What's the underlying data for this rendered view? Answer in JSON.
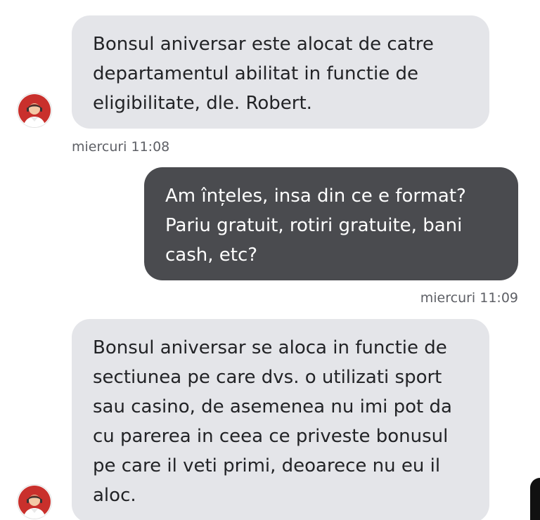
{
  "conversation": {
    "messages": [
      {
        "sender": "agent",
        "text": "Bonsul aniversar este alocat de catre departamentul abilitat in functie de eligibilitate, dle. Robert.",
        "timestamp": "miercuri 11:08"
      },
      {
        "sender": "user",
        "text": "Am înțeles, insa din ce e format? Pariu gratuit, rotiri gratuite, bani cash, etc?",
        "timestamp": "miercuri 11:09"
      },
      {
        "sender": "agent",
        "text": "Bonsul aniversar se aloca in functie de sectiunea pe care dvs. o utilizati sport sau casino, de asemenea nu imi pot da cu parerea in ceea ce priveste bonusul pe care il veti primi, deoarece nu eu il aloc.",
        "timestamp": ""
      }
    ]
  },
  "colors": {
    "agent_bubble": "#e4e5e9",
    "user_bubble": "#4a4b4f",
    "avatar_red": "#c9302c"
  },
  "icons": {
    "agent_avatar": "support-agent-avatar-icon"
  }
}
